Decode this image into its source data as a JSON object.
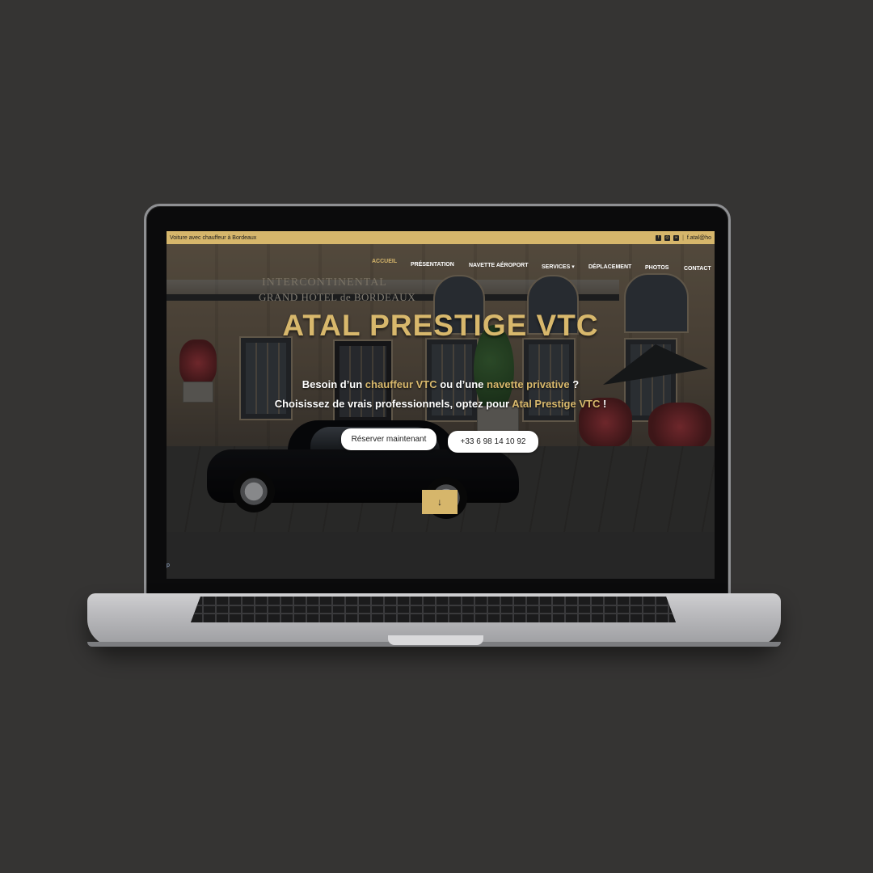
{
  "topbar": {
    "tagline": "Voiture avec chauffeur à Bordeaux",
    "email": "f.atal@ho",
    "social_icons": [
      "facebook-icon",
      "instagram-icon",
      "tripadvisor-icon"
    ]
  },
  "nav": {
    "items": [
      "ACCUEIL",
      "PRÉSENTATION",
      "NAVETTE AÉROPORT",
      "SERVICES",
      "DÉPLACEMENT",
      "PHOTOS",
      "CONTACT"
    ],
    "active": "ACCUEIL",
    "services_caret": "▾"
  },
  "hero": {
    "sign_line1": "INTERCONTINENTAL",
    "sign_line2": "GRAND HOTEL de BORDEAUX",
    "title": "ATAL PRESTIGE VTC",
    "line1_a": "Besoin d’un ",
    "line1_b": "chauffeur VTC",
    "line1_c": " ou d’une ",
    "line1_d": "navette privative",
    "line1_e": " ?",
    "line2_a": "Choisissez de vrais professionnels, optez pour ",
    "line2_b": "Atal Prestige VTC",
    "line2_c": " !",
    "btn_reserve": "Réserver maintenant",
    "btn_phone": "+33 6 98 14 10 92",
    "scroll_glyph": "↓"
  },
  "footer_hint": "p",
  "colors": {
    "accent_gold": "#d6b66b",
    "background": "#353433"
  }
}
